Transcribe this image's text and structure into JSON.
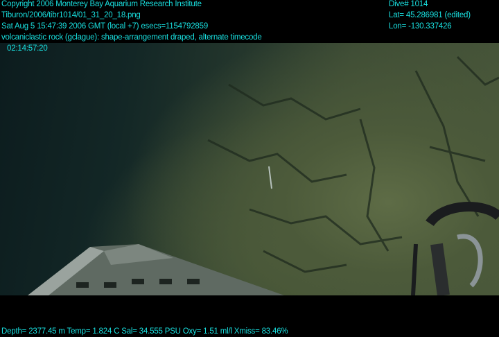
{
  "header_left": {
    "copyright": "Copyright 2006 Monterey Bay Aquarium Research Institute",
    "file": "Tiburon/2006/tibr1014/01_31_20_18.png",
    "datetime": "Sat Aug  5 15:47:39 2006 GMT (local +7)  esecs=1154792859",
    "annotation": "volcaniclastic rock (gclague): shape-arrangement draped, alternate timecode",
    "timecode": "02:14:57:20"
  },
  "header_right": {
    "dive": "Dive# 1014",
    "lat": "Lat= 45.286981 (edited)",
    "lon": "Lon= -130.337426"
  },
  "footer": {
    "sensors": "Depth= 2377.45 m  Temp= 1.824 C  Sal= 34.555 PSU  Oxy= 1.51 ml/l  Xmiss= 83.46%"
  },
  "colors": {
    "overlay_text": "#19e0e0"
  }
}
